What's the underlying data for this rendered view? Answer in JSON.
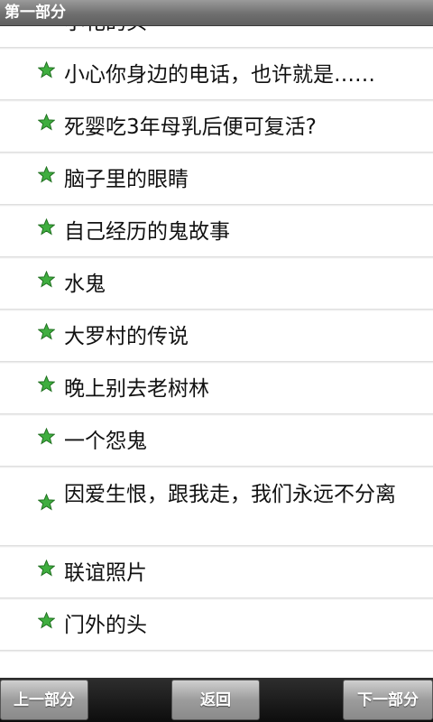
{
  "header": {
    "title": "第一部分"
  },
  "list": {
    "items": [
      {
        "label": "小花的头"
      },
      {
        "label": "小心你身边的电话，也许就是……"
      },
      {
        "label": "死婴吃3年母乳后便可复活?"
      },
      {
        "label": "脑子里的眼睛"
      },
      {
        "label": "自己经历的鬼故事"
      },
      {
        "label": "水鬼"
      },
      {
        "label": "大罗村的传说"
      },
      {
        "label": "晚上别去老树林"
      },
      {
        "label": "一个怨鬼"
      },
      {
        "label": "因爱生恨，跟我走，我们永远不分离"
      },
      {
        "label": "联谊照片"
      },
      {
        "label": "门外的头"
      }
    ],
    "icon": "star-icon",
    "star_color": "#3fae3f"
  },
  "footer": {
    "prev_label": "上一部分",
    "back_label": "返回",
    "next_label": "下一部分"
  }
}
